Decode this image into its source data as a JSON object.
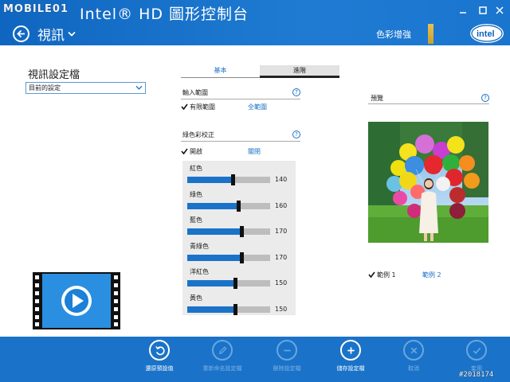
{
  "watermark": "MOBILE01",
  "header": {
    "app_title": "Intel® HD 圖形控制台",
    "nav_title": "視訊",
    "color_enhance": "色彩增強"
  },
  "profile": {
    "title": "視訊設定檔",
    "selected": "目前的設定"
  },
  "tabs": [
    {
      "label": "基本",
      "active": false
    },
    {
      "label": "進階",
      "active": true
    }
  ],
  "input_range": {
    "title": "輸入範圍",
    "help": "?",
    "options": [
      {
        "label": "有限範圍",
        "checked": true
      },
      {
        "label": "全範圍",
        "checked": false
      }
    ]
  },
  "green_correction": {
    "title": "綠色彩校正",
    "help": "?",
    "options": [
      {
        "label": "開啟",
        "checked": true
      },
      {
        "label": "關閉",
        "checked": false
      }
    ]
  },
  "sliders": [
    {
      "label": "紅色",
      "value": "140",
      "fraction": 0.55
    },
    {
      "label": "綠色",
      "value": "160",
      "fraction": 0.62
    },
    {
      "label": "藍色",
      "value": "170",
      "fraction": 0.65
    },
    {
      "label": "青綠色",
      "value": "170",
      "fraction": 0.65
    },
    {
      "label": "洋紅色",
      "value": "150",
      "fraction": 0.58
    },
    {
      "label": "黃色",
      "value": "150",
      "fraction": 0.58
    }
  ],
  "preview": {
    "title": "預覽",
    "help": "?",
    "samples": [
      {
        "label": "範例 1",
        "checked": true
      },
      {
        "label": "範例 2",
        "checked": false
      }
    ]
  },
  "appbar": {
    "restore": "還原預設值",
    "rename": "重新命名設定檔",
    "delete": "刪除設定檔",
    "save": "儲存設定檔",
    "cancel": "取消",
    "apply": "套用"
  },
  "post_id": "#2018174",
  "colors": {
    "accent": "#1a73c9",
    "link": "#1a6fc4"
  }
}
